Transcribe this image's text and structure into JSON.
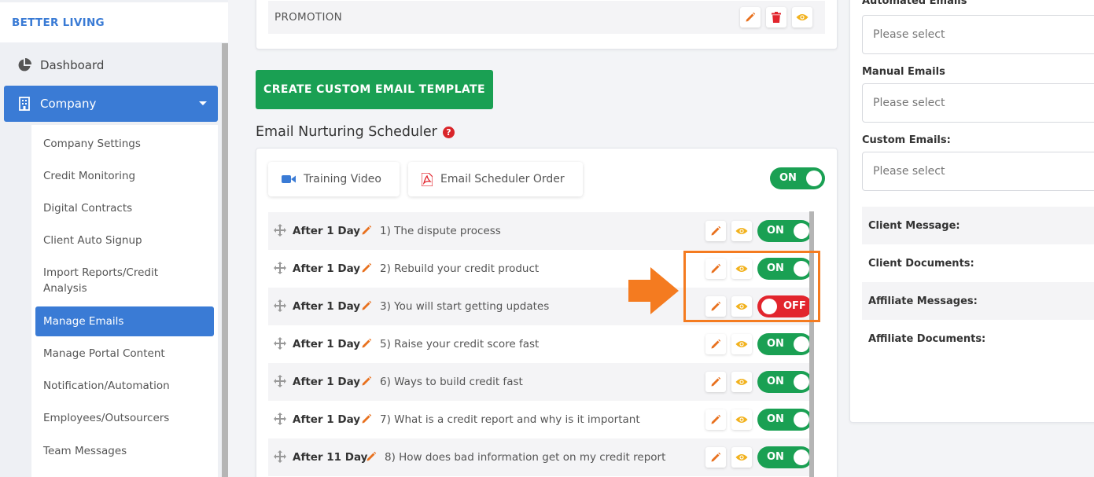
{
  "sidebar": {
    "brand": "BETTER LIVING",
    "dashboard_label": "Dashboard",
    "company_label": "Company",
    "company_sub": [
      "Company Settings",
      "Credit Monitoring",
      "Digital Contracts",
      "Client Auto Signup",
      "Import Reports/Credit Analysis",
      "Manage Emails",
      "Manage Portal Content",
      "Notification/Automation",
      "Employees/Outsourcers",
      "Team Messages"
    ],
    "active_sub": "Manage Emails"
  },
  "main": {
    "promotion_label": "PROMOTION",
    "create_button": "CREATE CUSTOM EMAIL TEMPLATE",
    "scheduler_title": "Email Nurturing Scheduler",
    "help_glyph": "?",
    "training_video": "Training Video",
    "scheduler_order": "Email Scheduler Order",
    "master_toggle": "ON",
    "rows": [
      {
        "day": "After 1 Day",
        "title": "1) The dispute process",
        "status": "ON"
      },
      {
        "day": "After 1 Day",
        "title": "2) Rebuild your credit product",
        "status": "ON"
      },
      {
        "day": "After 1 Day",
        "title": "3) You will start getting updates",
        "status": "OFF"
      },
      {
        "day": "After 1 Day",
        "title": "5) Raise your credit score fast",
        "status": "ON"
      },
      {
        "day": "After 1 Day",
        "title": "6) Ways to build credit fast",
        "status": "ON"
      },
      {
        "day": "After 1 Day",
        "title": "7) What is a credit report and why is it important",
        "status": "ON"
      },
      {
        "day": "After 11 Day",
        "title": "8) How does bad information get on my credit report",
        "status": "ON"
      }
    ]
  },
  "right": {
    "automated_label": "Automated Emails",
    "automated_placeholder": "Please select",
    "manual_label": "Manual Emails",
    "manual_placeholder": "Please select",
    "custom_label": "Custom Emails:",
    "custom_placeholder": "Please select",
    "client_message": "Client Message:",
    "client_documents": "Client Documents:",
    "affiliate_messages": "Affiliate Messages:",
    "affiliate_documents": "Affiliate Documents:"
  },
  "icons": {
    "dashboard": "pie-chart-icon",
    "company": "building-icon",
    "edit": "pencil-icon",
    "delete": "trash-icon",
    "view": "eye-icon",
    "drag": "move-icon",
    "video": "video-camera-icon",
    "pdf": "pdf-file-icon",
    "callout": "orange-arrow-icon"
  },
  "colors": {
    "primary": "#3a7bd5",
    "success": "#1aa053",
    "danger": "#e2252d",
    "edit_icon": "#e8711f",
    "view_icon": "#f2b21d",
    "highlight": "#f47b20"
  }
}
